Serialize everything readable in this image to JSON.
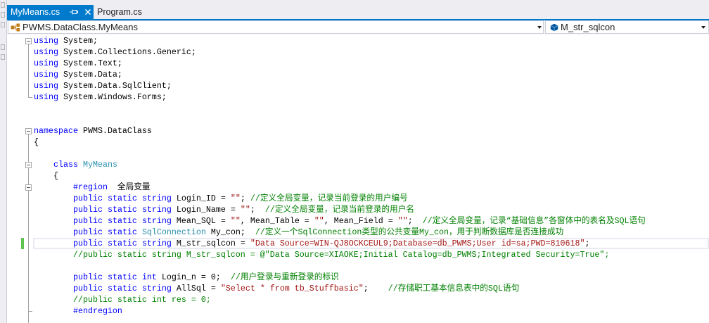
{
  "tabs": [
    {
      "label": "MyMeans.cs",
      "active": true,
      "pin_icon": "pin-icon",
      "close_icon": "close-icon"
    },
    {
      "label": "Program.cs",
      "active": false
    }
  ],
  "navbar": {
    "type_dropdown": {
      "value": "PWMS.DataClass.MyMeans",
      "icon": "class-icon"
    },
    "member_dropdown": {
      "value": "M_str_sqlcon",
      "icon": "field-icon"
    }
  },
  "colors": {
    "accent": "#007acc",
    "keyword": "#0000ff",
    "type": "#2b91af",
    "string": "#a31515",
    "comment": "#008000",
    "preprocessor": "#0000ff",
    "text": "#000000",
    "change_indicator": "#5fc44f",
    "current_line_border": "#eaeaf2",
    "outline": "#a5a5a5"
  },
  "editor": {
    "lines": [
      {
        "collapsible": true,
        "guide_below": true,
        "tokens": [
          {
            "kw": "using"
          },
          {
            "plain": " System;"
          }
        ]
      },
      {
        "guide_above": true,
        "guide_below": true,
        "tokens": [
          {
            "kw": "using"
          },
          {
            "plain": " System.Collections.Generic;"
          }
        ]
      },
      {
        "guide_above": true,
        "guide_below": true,
        "tokens": [
          {
            "kw": "using"
          },
          {
            "plain": " System.Text;"
          }
        ]
      },
      {
        "guide_above": true,
        "guide_below": true,
        "tokens": [
          {
            "kw": "using"
          },
          {
            "plain": " System.Data;"
          }
        ]
      },
      {
        "guide_above": true,
        "guide_below": true,
        "tokens": [
          {
            "kw": "using"
          },
          {
            "plain": " System.Data.SqlClient;"
          }
        ]
      },
      {
        "region_end": true,
        "guide_above": true,
        "tokens": [
          {
            "kw": "using"
          },
          {
            "plain": " System.Windows.Forms;"
          }
        ]
      },
      {
        "tokens": []
      },
      {
        "tokens": []
      },
      {
        "collapsible": true,
        "guide_below": true,
        "tokens": [
          {
            "kw": "namespace"
          },
          {
            "plain": " PWMS.DataClass"
          }
        ]
      },
      {
        "guide_above": true,
        "guide_below": true,
        "tokens": [
          {
            "plain": "{"
          }
        ]
      },
      {
        "guide_above": true,
        "guide_below": true,
        "tokens": []
      },
      {
        "collapsible": true,
        "guide_above": true,
        "guide_below": true,
        "tokens": [
          {
            "plain": "    "
          },
          {
            "kw": "class"
          },
          {
            "plain": " "
          },
          {
            "type": "MyMeans"
          }
        ]
      },
      {
        "guide_above": true,
        "guide_below": true,
        "tokens": [
          {
            "plain": "    {"
          }
        ]
      },
      {
        "collapsible": true,
        "guide_above": true,
        "guide_below": true,
        "tokens": [
          {
            "plain": "        "
          },
          {
            "pp": "#region"
          },
          {
            "plain": "  全局变量"
          }
        ]
      },
      {
        "guide_above": true,
        "guide_below": true,
        "tokens": [
          {
            "plain": "        "
          },
          {
            "kw": "public"
          },
          {
            "plain": " "
          },
          {
            "kw": "static"
          },
          {
            "plain": " "
          },
          {
            "kw": "string"
          },
          {
            "plain": " Login_ID = "
          },
          {
            "str": "\"\""
          },
          {
            "plain": "; "
          },
          {
            "com": "//定义全局变量，记录当前登录的用户编号"
          }
        ]
      },
      {
        "guide_above": true,
        "guide_below": true,
        "tokens": [
          {
            "plain": "        "
          },
          {
            "kw": "public"
          },
          {
            "plain": " "
          },
          {
            "kw": "static"
          },
          {
            "plain": " "
          },
          {
            "kw": "string"
          },
          {
            "plain": " Login_Name = "
          },
          {
            "str": "\"\""
          },
          {
            "plain": ";  "
          },
          {
            "com": "//定义全局变量，记录当前登录的用户名"
          }
        ]
      },
      {
        "guide_above": true,
        "guide_below": true,
        "tokens": [
          {
            "plain": "        "
          },
          {
            "kw": "public"
          },
          {
            "plain": " "
          },
          {
            "kw": "static"
          },
          {
            "plain": " "
          },
          {
            "kw": "string"
          },
          {
            "plain": " Mean_SQL = "
          },
          {
            "str": "\"\""
          },
          {
            "plain": ", Mean_Table = "
          },
          {
            "str": "\"\""
          },
          {
            "plain": ", Mean_Field = "
          },
          {
            "str": "\"\""
          },
          {
            "plain": ";  "
          },
          {
            "com": "//定义全局变量，记录“基础信息”各窗体中的表名及SQL语句"
          }
        ]
      },
      {
        "guide_above": true,
        "guide_below": true,
        "tokens": [
          {
            "plain": "        "
          },
          {
            "kw": "public"
          },
          {
            "plain": " "
          },
          {
            "kw": "static"
          },
          {
            "plain": " "
          },
          {
            "type": "SqlConnection"
          },
          {
            "plain": " My_con;  "
          },
          {
            "com": "//定义一个SqlConnection类型的公共变量My_con，用于判断数据库是否连接成功"
          }
        ]
      },
      {
        "current": true,
        "changed": true,
        "guide_above": true,
        "guide_below": true,
        "tokens": [
          {
            "plain": "        "
          },
          {
            "kw": "public"
          },
          {
            "plain": " "
          },
          {
            "kw": "static"
          },
          {
            "plain": " "
          },
          {
            "kw": "string"
          },
          {
            "plain": " M_str_sqlcon = "
          },
          {
            "str": "\"Data Source=WIN-QJ8OCKCEUL9;Database=db_PWMS;User id=sa;PWD=810618\""
          },
          {
            "plain": ";"
          }
        ]
      },
      {
        "guide_above": true,
        "guide_below": true,
        "tokens": [
          {
            "plain": "        "
          },
          {
            "com": "//public static string M_str_sqlcon = @\"Data Source=XIAOKE;Initial Catalog=db_PWMS;Integrated Security=True\";"
          }
        ]
      },
      {
        "guide_above": true,
        "guide_below": true,
        "tokens": []
      },
      {
        "guide_above": true,
        "guide_below": true,
        "tokens": [
          {
            "plain": "        "
          },
          {
            "kw": "public"
          },
          {
            "plain": " "
          },
          {
            "kw": "static"
          },
          {
            "plain": " "
          },
          {
            "kw": "int"
          },
          {
            "plain": " Login_n = 0;  "
          },
          {
            "com": "//用户登录与重新登录的标识"
          }
        ]
      },
      {
        "guide_above": true,
        "guide_below": true,
        "tokens": [
          {
            "plain": "        "
          },
          {
            "kw": "public"
          },
          {
            "plain": " "
          },
          {
            "kw": "static"
          },
          {
            "plain": " "
          },
          {
            "kw": "string"
          },
          {
            "plain": " AllSql = "
          },
          {
            "str": "\"Select * from tb_Stuffbasic\""
          },
          {
            "plain": ";    "
          },
          {
            "com": "//存储职工基本信息表中的SQL语句"
          }
        ]
      },
      {
        "guide_above": true,
        "guide_below": true,
        "tokens": [
          {
            "plain": "        "
          },
          {
            "com": "//public static int res = 0;"
          }
        ]
      },
      {
        "region_end": true,
        "guide_above": true,
        "guide_below": true,
        "tokens": [
          {
            "plain": "        "
          },
          {
            "pp": "#endregion"
          }
        ]
      },
      {
        "guide_above": true,
        "guide_below": true,
        "tokens": []
      }
    ]
  }
}
